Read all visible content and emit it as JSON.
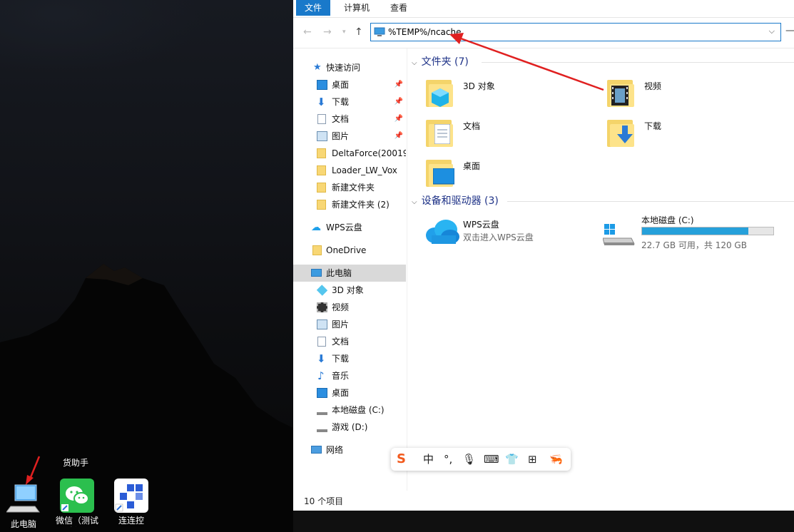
{
  "desktop": {
    "helper_text": "货助手",
    "icons": [
      {
        "label": "此电脑"
      },
      {
        "label": "微信（测试版）"
      },
      {
        "label": "连连控"
      }
    ]
  },
  "explorer": {
    "ribbon_tabs": [
      "文件",
      "计算机",
      "查看"
    ],
    "address": "%TEMP%/ncache",
    "nav": {
      "quick_access": "快速访问",
      "quick_items": [
        "桌面",
        "下载",
        "文档",
        "图片",
        "DeltaForce(20019",
        "Loader_LW_Vox",
        "新建文件夹",
        "新建文件夹 (2)"
      ],
      "wps": "WPS云盘",
      "onedrive": "OneDrive",
      "this_pc": "此电脑",
      "pc_items": [
        "3D 对象",
        "视频",
        "图片",
        "文档",
        "下载",
        "音乐",
        "桌面",
        "本地磁盘 (C:)",
        "游戏 (D:)"
      ],
      "network": "网络"
    },
    "content": {
      "folders_header": "文件夹 (7)",
      "folders": [
        "3D 对象",
        "视频",
        "文档",
        "下载",
        "桌面"
      ],
      "devices_header": "设备和驱动器 (3)",
      "wps_name": "WPS云盘",
      "wps_sub": "双击进入WPS云盘",
      "disk_c_name": "本地磁盘 (C:)",
      "disk_c_info": "22.7 GB 可用，共 120 GB",
      "disk_c_used_fraction": 0.81
    },
    "status": "10 个项目"
  },
  "ime": {
    "items": [
      "S",
      "中",
      "°,",
      "mic",
      "kbd",
      "shirt",
      "grid",
      "skin"
    ]
  },
  "colors": {
    "accent": "#1979ca",
    "header": "#1e3287",
    "arrow": "#e02020",
    "disk_bar": "#26a0da"
  }
}
